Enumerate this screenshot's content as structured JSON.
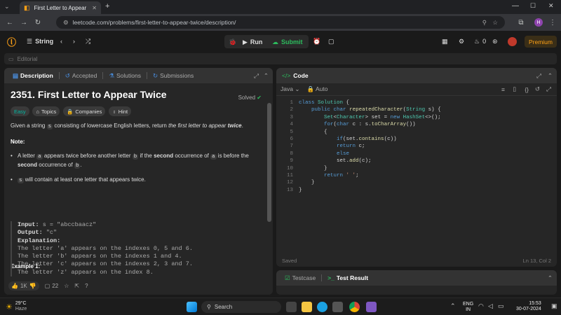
{
  "browser": {
    "tab_title": "First Letter to Appear Twice - L",
    "url": "leetcode.com/problems/first-letter-to-appear-twice/description/"
  },
  "nav": {
    "problem_list": "String",
    "run": "Run",
    "submit": "Submit",
    "streak": "0",
    "premium": "Premium"
  },
  "editorial": "Editorial",
  "left_tabs": [
    "Description",
    "Accepted",
    "Solutions",
    "Submissions"
  ],
  "problem": {
    "title": "2351. First Letter to Appear Twice",
    "solved": "Solved",
    "difficulty": "Easy",
    "chips": [
      "Topics",
      "Companies",
      "Hint"
    ],
    "stmt_pre": "Given a string",
    "stmt_var": "s",
    "stmt_mid": "consisting of lowercase English letters, return",
    "stmt_em": "the first letter to appear",
    "stmt_strong": "twice",
    "note": "Note",
    "b1_a": "A letter",
    "b1_v1": "a",
    "b1_b": "appears twice before another letter",
    "b1_v2": "b",
    "b1_c": "if the",
    "b1_d": "second",
    "b1_e": "occurrence of",
    "b1_v3": "a",
    "b1_f": "is before the",
    "b1_g": "second",
    "b1_h": "occurrence of",
    "b1_v4": "b",
    "b2_v": "s",
    "b2_t": "will contain at least one letter that appears twice.",
    "example_title": "Example 1:",
    "ex_input_label": "Input:",
    "ex_input": "s = \"abccbaacz\"",
    "ex_output_label": "Output:",
    "ex_output": "\"c\"",
    "ex_expl_label": "Explanation:",
    "ex_lines": [
      "The letter 'a' appears on the indexes 0, 5 and 6.",
      "The letter 'b' appears on the indexes 1 and 4.",
      "The letter 'c' appears on the indexes 2, 3 and 7.",
      "The letter 'z' appears on the index 8."
    ]
  },
  "left_footer": {
    "likes": "1K",
    "comments": "22"
  },
  "code": {
    "header": "Code",
    "language": "Java",
    "auto": "Auto",
    "line_numbers": [
      "1",
      "2",
      "3",
      "4",
      "5",
      "6",
      "7",
      "8",
      "9",
      "10",
      "11",
      "12",
      "13"
    ],
    "saved": "Saved",
    "cursor": "Ln 13, Col 2"
  },
  "test": {
    "testcase": "Testcase",
    "result": "Test Result"
  },
  "taskbar": {
    "temp": "29°C",
    "weather": "Haze",
    "search": "Search",
    "lang1": "ENG",
    "lang2": "IN",
    "time": "15:53",
    "date": "30-07-2024"
  },
  "colors": {
    "accent": "#ffa116",
    "green": "#2cbb5d",
    "easy": "#00b8a3"
  }
}
